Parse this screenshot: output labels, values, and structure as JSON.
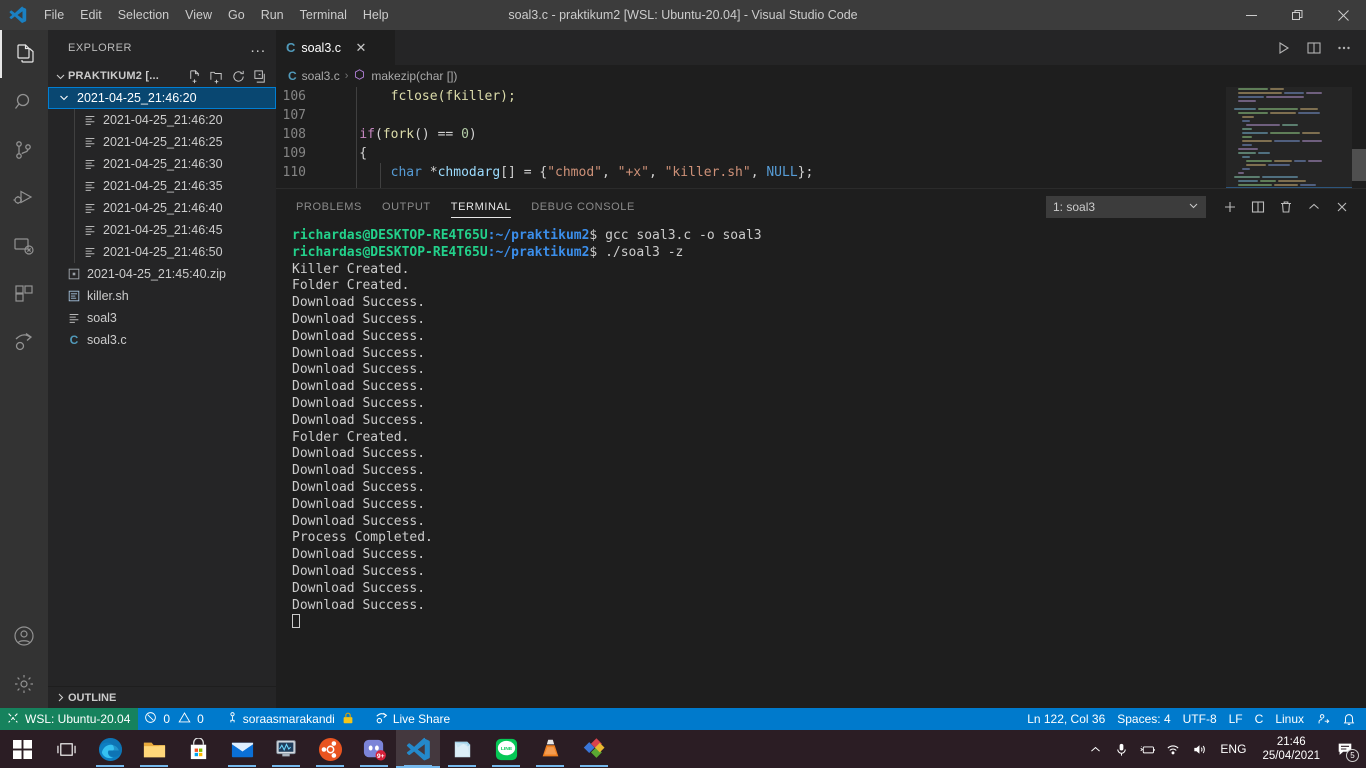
{
  "titlebar": {
    "title": "soal3.c - praktikum2 [WSL: Ubuntu-20.04] - Visual Studio Code",
    "menu": [
      "File",
      "Edit",
      "Selection",
      "View",
      "Go",
      "Run",
      "Terminal",
      "Help"
    ],
    "window_controls": [
      "minimize-icon",
      "restore-icon",
      "close-icon"
    ]
  },
  "activitybar": {
    "top": [
      "explorer-icon",
      "search-icon",
      "source-control-icon",
      "run-debug-icon",
      "remote-explorer-icon",
      "extensions-icon",
      "live-share-icon"
    ],
    "bottom": [
      "accounts-icon",
      "settings-gear-icon"
    ]
  },
  "sidebar": {
    "title": "EXPLORER",
    "more_actions": "...",
    "folder": "PRAKTIKUM2 [...",
    "folder_actions": [
      "new-file-icon",
      "new-folder-icon",
      "refresh-icon",
      "collapse-all-icon"
    ],
    "outline_label": "OUTLINE",
    "items": [
      {
        "label": "2021-04-25_21:46:20",
        "icon": "folder-open-icon",
        "depth": 0,
        "selected": true,
        "expanded": true
      },
      {
        "label": "2021-04-25_21:46:20",
        "icon": "image-file-icon",
        "depth": 1,
        "selected": false
      },
      {
        "label": "2021-04-25_21:46:25",
        "icon": "image-file-icon",
        "depth": 1,
        "selected": false
      },
      {
        "label": "2021-04-25_21:46:30",
        "icon": "image-file-icon",
        "depth": 1,
        "selected": false
      },
      {
        "label": "2021-04-25_21:46:35",
        "icon": "image-file-icon",
        "depth": 1,
        "selected": false
      },
      {
        "label": "2021-04-25_21:46:40",
        "icon": "image-file-icon",
        "depth": 1,
        "selected": false
      },
      {
        "label": "2021-04-25_21:46:45",
        "icon": "image-file-icon",
        "depth": 1,
        "selected": false
      },
      {
        "label": "2021-04-25_21:46:50",
        "icon": "image-file-icon",
        "depth": 1,
        "selected": false
      },
      {
        "label": "2021-04-25_21:45:40.zip",
        "icon": "zip-file-icon",
        "depth": 0,
        "selected": false
      },
      {
        "label": "killer.sh",
        "icon": "shell-file-icon",
        "depth": 0,
        "selected": false
      },
      {
        "label": "soal3",
        "icon": "binary-file-icon",
        "depth": 0,
        "selected": false
      },
      {
        "label": "soal3.c",
        "icon": "c-file-icon",
        "depth": 0,
        "selected": false
      }
    ]
  },
  "editor": {
    "tab": {
      "label": "soal3.c",
      "icon": "c-file-icon",
      "close": "✕"
    },
    "tab_actions": [
      "run-icon",
      "split-editor-icon",
      "more-actions-icon"
    ],
    "breadcrumb": {
      "file": "soal3.c",
      "separator": "›",
      "symbol": "makezip(char [])"
    },
    "code": [
      {
        "num": "106",
        "tokens": [
          {
            "t": "        fclose(fkiller);",
            "c": "#dcdcaa"
          }
        ]
      },
      {
        "num": "107",
        "tokens": [
          {
            "t": "",
            "c": "#d4d4d4"
          }
        ]
      },
      {
        "num": "108",
        "tokens": [
          {
            "t": "    ",
            "c": "#d4d4d4"
          },
          {
            "t": "if",
            "c": "#c586c0"
          },
          {
            "t": "(",
            "c": "#d4d4d4"
          },
          {
            "t": "fork",
            "c": "#dcdcaa"
          },
          {
            "t": "() == ",
            "c": "#d4d4d4"
          },
          {
            "t": "0",
            "c": "#b5cea8"
          },
          {
            "t": ")",
            "c": "#d4d4d4"
          }
        ]
      },
      {
        "num": "109",
        "tokens": [
          {
            "t": "    {",
            "c": "#d4d4d4"
          }
        ]
      },
      {
        "num": "110",
        "tokens": [
          {
            "t": "        ",
            "c": "#d4d4d4"
          },
          {
            "t": "char",
            "c": "#569cd6"
          },
          {
            "t": " *",
            "c": "#d4d4d4"
          },
          {
            "t": "chmodarg",
            "c": "#9cdcfe"
          },
          {
            "t": "[] = {",
            "c": "#d4d4d4"
          },
          {
            "t": "\"chmod\"",
            "c": "#ce9178"
          },
          {
            "t": ", ",
            "c": "#d4d4d4"
          },
          {
            "t": "\"+x\"",
            "c": "#ce9178"
          },
          {
            "t": ", ",
            "c": "#d4d4d4"
          },
          {
            "t": "\"killer.sh\"",
            "c": "#ce9178"
          },
          {
            "t": ", ",
            "c": "#d4d4d4"
          },
          {
            "t": "NULL",
            "c": "#569cd6"
          },
          {
            "t": "};",
            "c": "#d4d4d4"
          }
        ]
      }
    ]
  },
  "panel": {
    "tabs": [
      "PROBLEMS",
      "OUTPUT",
      "TERMINAL",
      "DEBUG CONSOLE"
    ],
    "active_tab": "TERMINAL",
    "terminal_select": "1: soal3",
    "select_caret": "⌄",
    "actions": [
      "new-terminal-icon",
      "split-terminal-icon",
      "kill-terminal-icon",
      "maximize-panel-icon",
      "close-panel-icon"
    ],
    "prompt_user": "richardas@DESKTOP-RE4T65U",
    "prompt_path": ":~/praktikum2",
    "prompt_dollar": "$",
    "commands": [
      " gcc soal3.c -o soal3",
      " ./soal3 -z"
    ],
    "output": [
      "Killer Created.",
      "Folder Created.",
      "Download Success.",
      "Download Success.",
      "Download Success.",
      "Download Success.",
      "Download Success.",
      "Download Success.",
      "Download Success.",
      "Download Success.",
      "Folder Created.",
      "Download Success.",
      "Download Success.",
      "Download Success.",
      "Download Success.",
      "Download Success.",
      "Process Completed.",
      "Download Success.",
      "Download Success.",
      "Download Success.",
      "Download Success."
    ]
  },
  "statusbar": {
    "remote": "WSL: Ubuntu-20.04",
    "errors": "0",
    "warnings": "0",
    "account": "soraasmarakandi",
    "live_share": "Live Share",
    "position": "Ln 122, Col 36",
    "spaces": "Spaces: 4",
    "encoding": "UTF-8",
    "eol": "LF",
    "language": "C",
    "platform": "Linux",
    "right_icons": [
      "feedback-icon",
      "bell-icon"
    ]
  },
  "taskbar": {
    "icons": [
      "start-windows-icon",
      "task-view-icon",
      "edge-icon",
      "file-explorer-icon",
      "microsoft-store-icon",
      "mail-icon",
      "system-monitor-icon",
      "ubuntu-icon",
      "discord-icon",
      "vscode-icon",
      "notes-icon",
      "line-icon",
      "vlc-icon",
      "app-icon"
    ],
    "tray": {
      "chevron": "⌃",
      "icons": [
        "microphone-icon",
        "battery-icon",
        "wifi-icon",
        "volume-icon"
      ],
      "language": "ENG",
      "time": "21:46",
      "date": "25/04/2021",
      "notification_count": "5"
    }
  },
  "colors": {
    "accent": "#007acc",
    "remote_green": "#16825d",
    "selection_blue": "#094771",
    "terminal_green": "#23d18b",
    "terminal_blue": "#3b8eea"
  }
}
